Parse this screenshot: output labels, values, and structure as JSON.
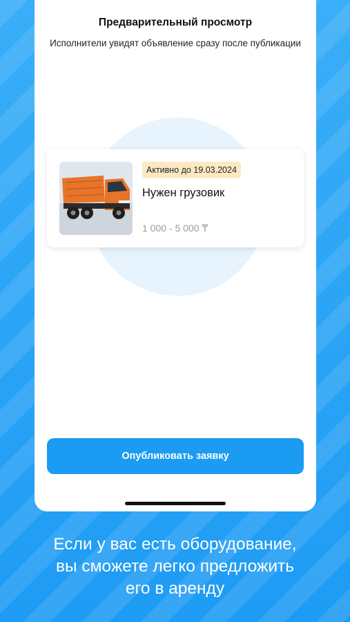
{
  "colors": {
    "accent": "#1C9BF3",
    "background": "#2AA3F6",
    "badge_bg": "#FCE9C4",
    "circle": "#E7F4FD",
    "truck_body": "#E8742A"
  },
  "preview": {
    "title": "Предварительный просмотр",
    "subtitle": "Исполнители увидят объявление сразу после публикации"
  },
  "listing": {
    "image_icon": "orange-dump-truck",
    "status": "Активно до 19.03.2024",
    "title": "Нужен грузовик",
    "price": "1 000 - 5 000 ₸"
  },
  "actions": {
    "publish_label": "Опубликовать заявку"
  },
  "promo": {
    "lines": [
      "Если у вас есть оборудование,",
      "вы сможете легко предложить",
      "его в аренду"
    ]
  }
}
